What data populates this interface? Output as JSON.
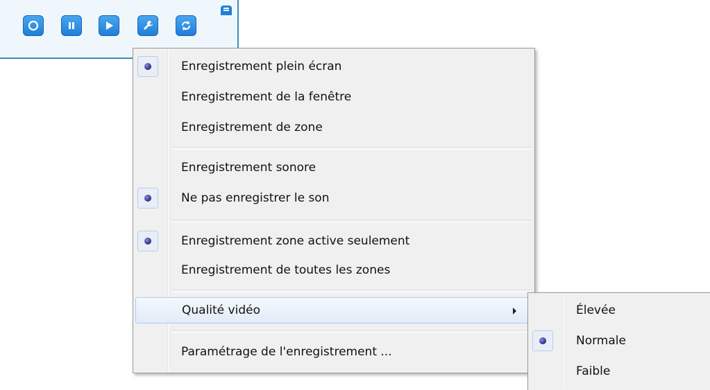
{
  "toolbar": {
    "buttons": [
      {
        "name": "record",
        "icon": "record-icon"
      },
      {
        "name": "pause",
        "icon": "pause-icon"
      },
      {
        "name": "play",
        "icon": "play-icon"
      },
      {
        "name": "settings",
        "icon": "wrench-icon"
      },
      {
        "name": "loop",
        "icon": "loop-icon"
      }
    ]
  },
  "menu": {
    "items": [
      {
        "label": "Enregistrement plein écran",
        "checked": true
      },
      {
        "label": "Enregistrement de la fenêtre",
        "checked": false
      },
      {
        "label": "Enregistrement de zone",
        "checked": false
      },
      {
        "label": "Enregistrement sonore",
        "checked": false
      },
      {
        "label": "Ne pas enregistrer le son",
        "checked": true
      },
      {
        "label": "Enregistrement zone active seulement",
        "checked": true
      },
      {
        "label": "Enregistrement de toutes les zones",
        "checked": false
      },
      {
        "label": "Qualité vidéo",
        "submenu": true
      },
      {
        "label": "Paramétrage de l'enregistrement ..."
      }
    ]
  },
  "submenu": {
    "items": [
      {
        "label": "Élevée",
        "checked": false
      },
      {
        "label": "Normale",
        "checked": true
      },
      {
        "label": "Faible",
        "checked": false
      }
    ]
  }
}
